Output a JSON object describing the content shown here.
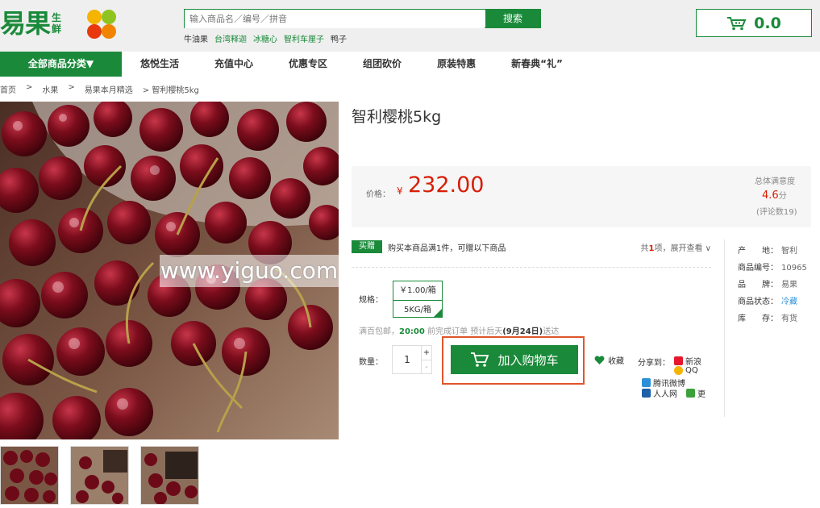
{
  "header": {
    "logo": "易果",
    "logo_sub1": "生",
    "logo_sub2": "鲜",
    "search_placeholder": "输入商品名／编号／拼音",
    "search_button": "搜索",
    "hotwords": [
      "牛油果",
      "台湾释迦",
      "冰糖心",
      "智利车厘子",
      "鸭子"
    ],
    "hotword_colors": [
      "#333333",
      "#1a8a3a",
      "#1a8a3a",
      "#1a8a3a",
      "#333333"
    ],
    "cart_amount": "0.0"
  },
  "nav": {
    "all_categories": "全部商品分类▼",
    "links": [
      "悠悦生活",
      "充值中心",
      "优惠专区",
      "组团砍价",
      "原装特惠",
      "新春典“礼”"
    ]
  },
  "breadcrumb": [
    "首页",
    ">",
    "水果",
    ">",
    "易果本月精选",
    "> 智利樱桃5kg"
  ],
  "image": {
    "watermark": "www.yiguo.com"
  },
  "product": {
    "title": "智利樱桃5kg",
    "price_label": "价格：",
    "price_symbol": "¥",
    "price": "232.00",
    "score_label": "总体满意度",
    "score": "4.6",
    "score_unit": "分",
    "review_count": "(评论数19)"
  },
  "promo": {
    "tag": "买赠",
    "text": "购买本商品满1件，可赠以下商品",
    "right_prefix": "共",
    "right_count": "1",
    "right_suffix": "项，展开查看 ∨"
  },
  "spec": {
    "label": "规格：",
    "unit_price": "￥1.00/箱",
    "option": "5KG/箱"
  },
  "shipping": {
    "a": "满百包邮，",
    "time": "20:00",
    "b": " 前完成订单  预计后天",
    "date": "(9月24日)",
    "c": "送达"
  },
  "quantity": {
    "label": "数量：",
    "value": "1",
    "plus": "+",
    "minus": "-"
  },
  "actions": {
    "add_to_cart": "加入购物车",
    "favorite": "收藏",
    "share_label": "分享到：",
    "share_sina": "新浪",
    "share_qq": "QQ",
    "share_tencent": "腾讯微博",
    "share_renren": "人人网",
    "share_more": "更"
  },
  "attributes": [
    {
      "key": "产　　地：",
      "value": "智利"
    },
    {
      "key": "商品编号：",
      "value": "10965"
    },
    {
      "key": "品　　牌：",
      "value": "易果"
    },
    {
      "key": "商品状态：",
      "value": "冷藏"
    },
    {
      "key": "库　　存：",
      "value": "有货"
    }
  ],
  "colors": {
    "brand_green": "#1a8a3a",
    "price_red": "#d81e06",
    "highlight_orange": "#e0552a"
  }
}
